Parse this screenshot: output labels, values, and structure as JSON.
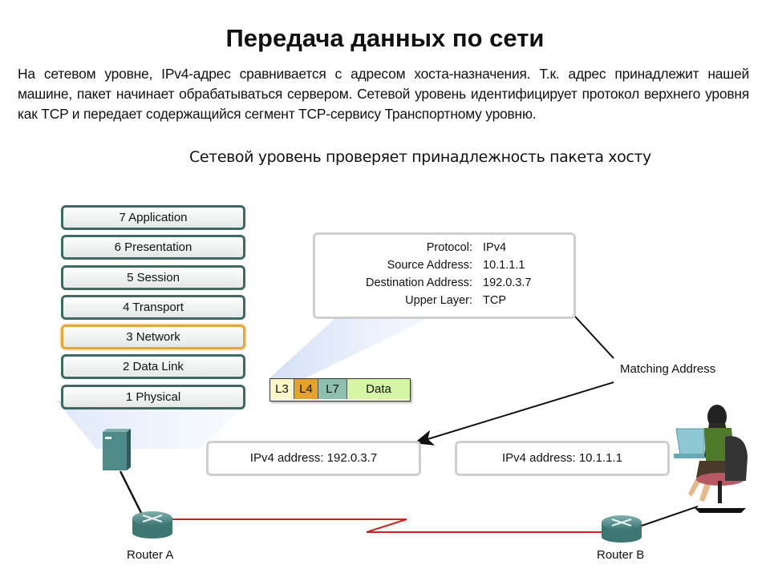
{
  "title": "Передача данных по сети",
  "paragraph": "На сетевом уровне, IPv4-адрес сравнивается с адресом хоста-назначения. Т.к. адрес принадлежит нашей машине, пакет начинает обрабатываться сервером. Сетевой уровень идентифицирует протокол верхнего уровня как TCP и передает содержащийся сегмент  TCP-сервису Транспортному уровню.",
  "subtitle": "Сетевой уровень проверяет принадлежность пакета хосту",
  "osi_layers": [
    {
      "label": "7 Application",
      "active": false
    },
    {
      "label": "6 Presentation",
      "active": false
    },
    {
      "label": "5 Session",
      "active": false
    },
    {
      "label": "4 Transport",
      "active": false
    },
    {
      "label": "3 Network",
      "active": true
    },
    {
      "label": "2 Data Link",
      "active": false
    },
    {
      "label": "1 Physical",
      "active": false
    }
  ],
  "header_info": [
    {
      "key": "Protocol:",
      "value": "IPv4"
    },
    {
      "key": "Source Address:",
      "value": "10.1.1.1"
    },
    {
      "key": "Destination Address:",
      "value": "192.0.3.7"
    },
    {
      "key": "Upper Layer:",
      "value": "TCP"
    }
  ],
  "packet": [
    {
      "label": "L3",
      "color": "#fdf6c8"
    },
    {
      "label": "L4",
      "color": "#e4a22e"
    },
    {
      "label": "L7",
      "color": "#8fbfae"
    },
    {
      "label": "Data",
      "color": "#d6f5a6"
    }
  ],
  "matching_label": "Matching Address",
  "server_address": "IPv4 address: 192.0.3.7",
  "client_address": "IPv4 address: 10.1.1.1",
  "router_a": "Router A",
  "router_b": "Router B",
  "colors": {
    "highlight": "#e0a73a",
    "layer_border": "#3f6a64",
    "serial_link": "#cc2222",
    "device": "#4f8a88"
  }
}
